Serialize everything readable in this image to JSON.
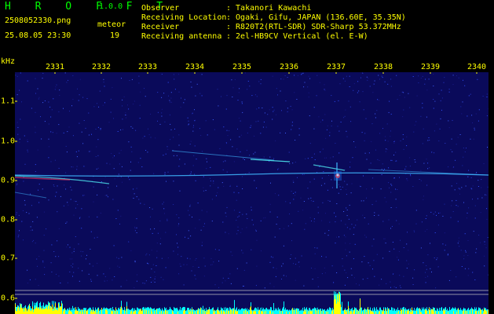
{
  "app": {
    "title": "H R O F F T",
    "version": "1.0.0"
  },
  "file": {
    "name": "2508052330.png",
    "timestamp": "25.08.05 23:30"
  },
  "meteor": {
    "label": "meteor",
    "count": "19"
  },
  "info": [
    {
      "label": "Observer",
      "value": ": Takanori Kawachi"
    },
    {
      "label": "Receiving Location",
      "value": ": Ogaki, Gifu, JAPAN (136.60E, 35.35N)"
    },
    {
      "label": "Receiver",
      "value": ": R820T2(RTL-SDR) SDR-Sharp 53.372MHz"
    },
    {
      "label": "Receiving antenna",
      "value": ": 2el-HB9CV Vertical (el. E-W)"
    }
  ],
  "axis": {
    "y_unit": "kHz",
    "x_ticks": [
      "2331",
      "2332",
      "2333",
      "2334",
      "2335",
      "2336",
      "2337",
      "2338",
      "2339",
      "2340"
    ],
    "y_ticks": [
      "1.1",
      "1.0",
      "0.9",
      "0.8",
      "0.7",
      "0.6"
    ]
  },
  "colors": {
    "label": "#ffff00",
    "title": "#00ff00",
    "background": "#0a0a5a",
    "signal": "#00ffff",
    "trace": "#ffff00"
  }
}
